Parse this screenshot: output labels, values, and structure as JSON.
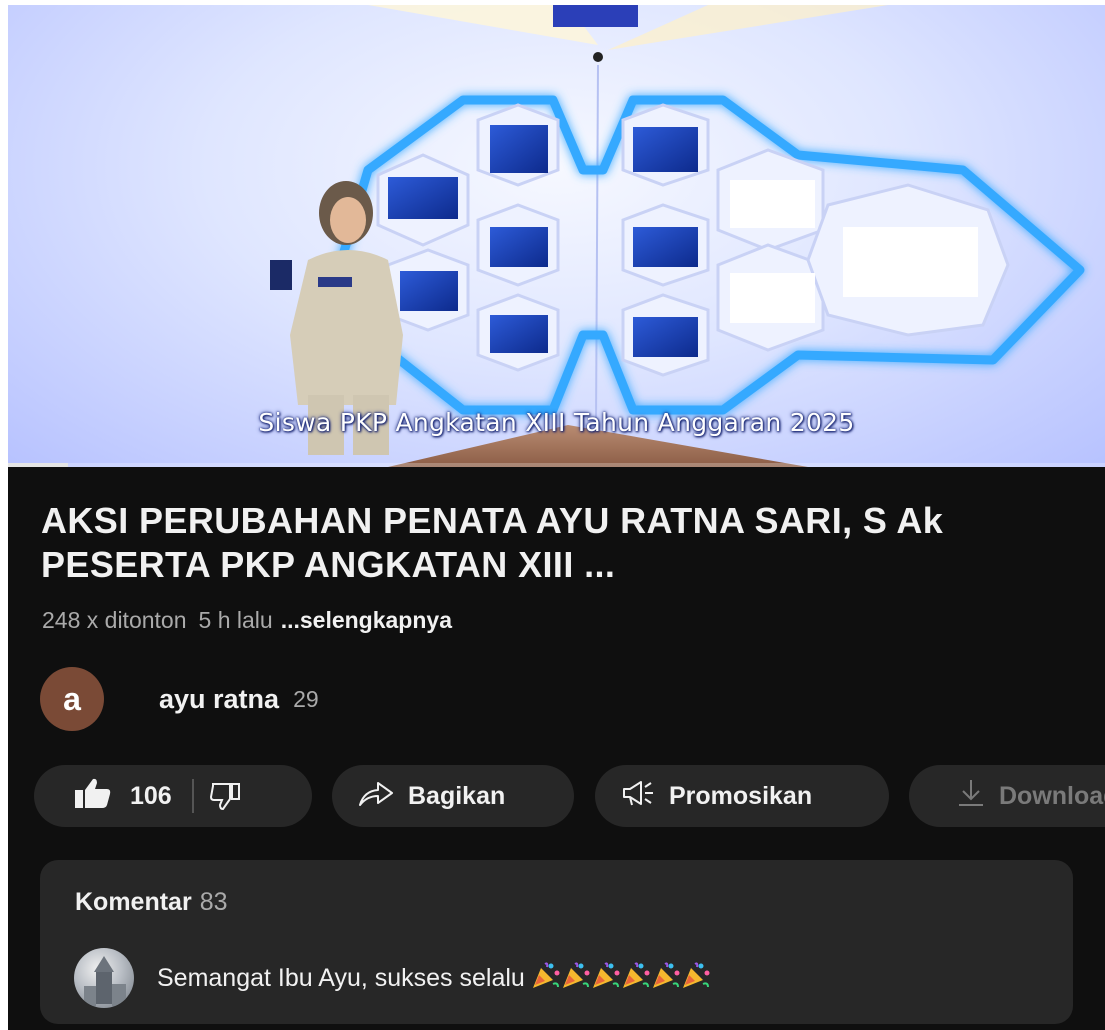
{
  "video": {
    "caption": "Siswa PKP Angkatan XIII Tahun Anggaran 2025",
    "progress_fraction": 0.055
  },
  "title": "AKSI PERUBAHAN PENATA AYU RATNA SARI, S Ak PESERTA PKP ANGKATAN XIII ...",
  "meta": {
    "views": "248 x ditonton",
    "time": "5 h lalu",
    "more": "...selengkapnya"
  },
  "channel": {
    "avatar_letter": "a",
    "avatar_color": "#7a4a36",
    "name": "ayu ratna",
    "subscribers": "29"
  },
  "actions": {
    "like_count": "106",
    "share_label": "Bagikan",
    "promote_label": "Promosikan",
    "download_label": "Download"
  },
  "comments": {
    "header": "Komentar",
    "count": "83",
    "top_comment_text": "Semangat Ibu Ayu, sukses selalu",
    "top_comment_emoji": "party-popper-icon",
    "top_comment_emoji_count": 6
  },
  "colors": {
    "background": "#0f0f0f",
    "pill": "#272727",
    "text_primary": "#f1f1f1",
    "text_secondary": "#aaaaaa",
    "neon": "#2fa7ff"
  }
}
